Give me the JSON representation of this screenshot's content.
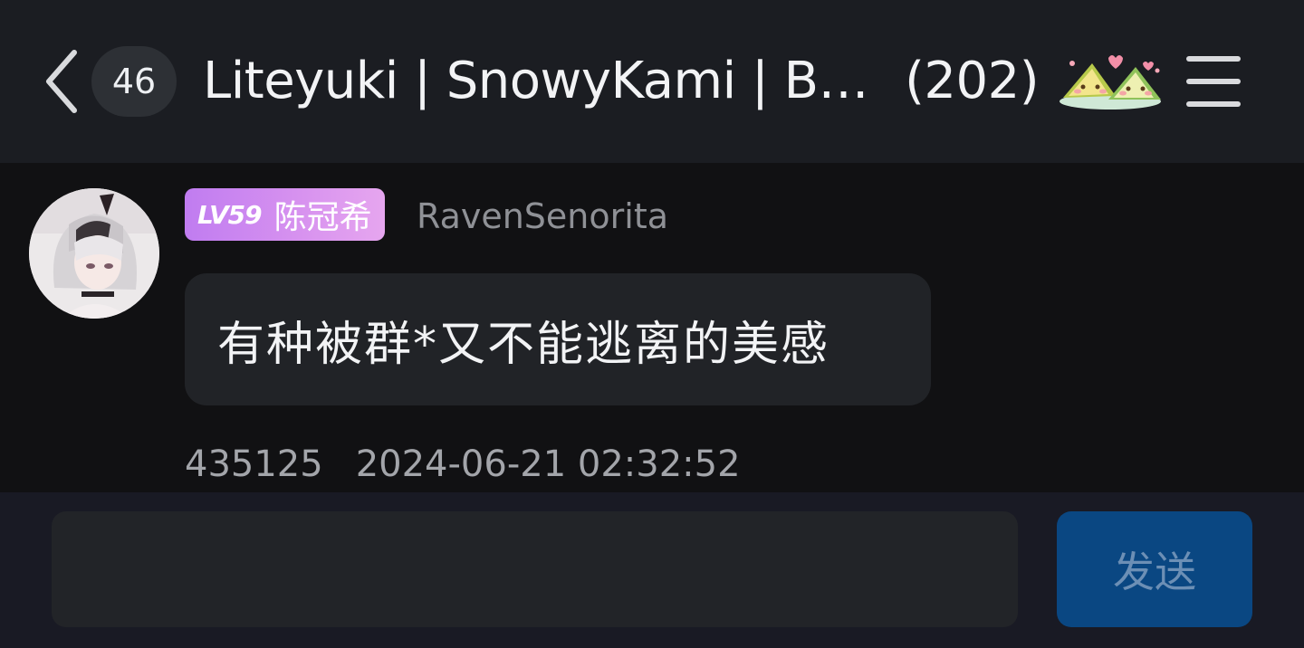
{
  "header": {
    "unread_count": "46",
    "group_name": "Liteyuki | SnowyKami | B…",
    "member_count": "(202)",
    "back_icon": "chevron-left-icon",
    "menu_icon": "hamburger-menu-icon",
    "sticker_icon": "zongzi-sticker-icon"
  },
  "message": {
    "level": "LV59",
    "member_title": "陈冠希",
    "nickname": "RavenSenorita",
    "text": "有种被群*又不能逃离的美感",
    "message_id": "435125",
    "timestamp": "2024-06-21 02:32:52",
    "tag_gradient": [
      "#c07cf0",
      "#e6a6ef"
    ]
  },
  "composer": {
    "input_value": "",
    "send_label": "发送",
    "send_color": "#0a4782"
  }
}
